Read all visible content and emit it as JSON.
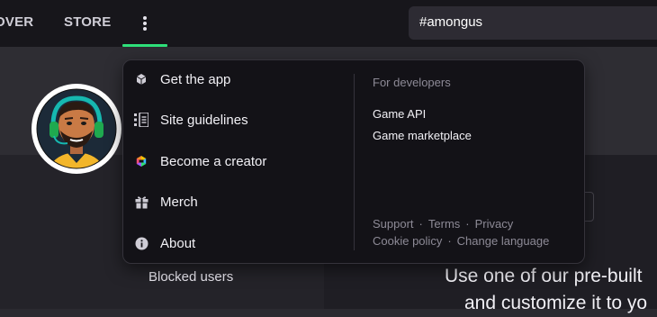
{
  "topnav": {
    "items": [
      "OVER",
      "STORE"
    ],
    "search_value": "#amongus",
    "more_icon": "vertical-dots-icon",
    "active_color": "#2ee07a"
  },
  "menu": {
    "items": [
      {
        "label": "Get the app",
        "icon": "package-icon"
      },
      {
        "label": "Site guidelines",
        "icon": "checklist-icon"
      },
      {
        "label": "Become a creator",
        "icon": "creator-cube-icon"
      },
      {
        "label": "Merch",
        "icon": "gift-icon"
      },
      {
        "label": "About",
        "icon": "info-icon"
      }
    ],
    "developers_heading": "For developers",
    "developer_links": [
      "Game API",
      "Game marketplace"
    ],
    "footer_links_row1": [
      "Support",
      "Terms",
      "Privacy"
    ],
    "footer_links_row2": [
      "Cookie policy",
      "Change language"
    ],
    "separator": "·"
  },
  "background": {
    "blocked_users": "Blocked users",
    "promo_line1": "Use one of our pre-built",
    "promo_line2": "and customize it to yo"
  }
}
